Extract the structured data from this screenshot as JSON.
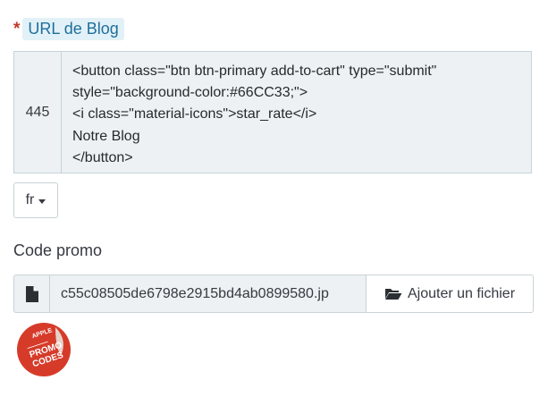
{
  "blog_field": {
    "required_marker": "*",
    "label": "URL de Blog",
    "line_number": "445",
    "code_lines": "<button class=\"btn btn-primary add-to-cart\" type=\"submit\"\nstyle=\"background-color:#66CC33;\">\n<i class=\"material-icons\">star_rate</i>\nNotre Blog\n</button>"
  },
  "language_selector": {
    "value": "fr",
    "icon": "caret-down-icon"
  },
  "promo_field": {
    "label": "Code promo",
    "file_icon": "file-icon",
    "file_name": "c55c08505de6798e2915bd4ab0899580.jp",
    "button_icon": "folder-open-icon",
    "button_label": "Ajouter un fichier"
  },
  "promo_badge": {
    "top_text": "APPLE",
    "main_text_1": "PROMO",
    "main_text_2": "CODES",
    "color": "#d63b2a"
  },
  "colors": {
    "label_chip_bg": "#e2f1f7",
    "label_chip_text": "#1f6f9c",
    "required_star": "#c0392b",
    "readonly_bg": "#edf1f3"
  }
}
